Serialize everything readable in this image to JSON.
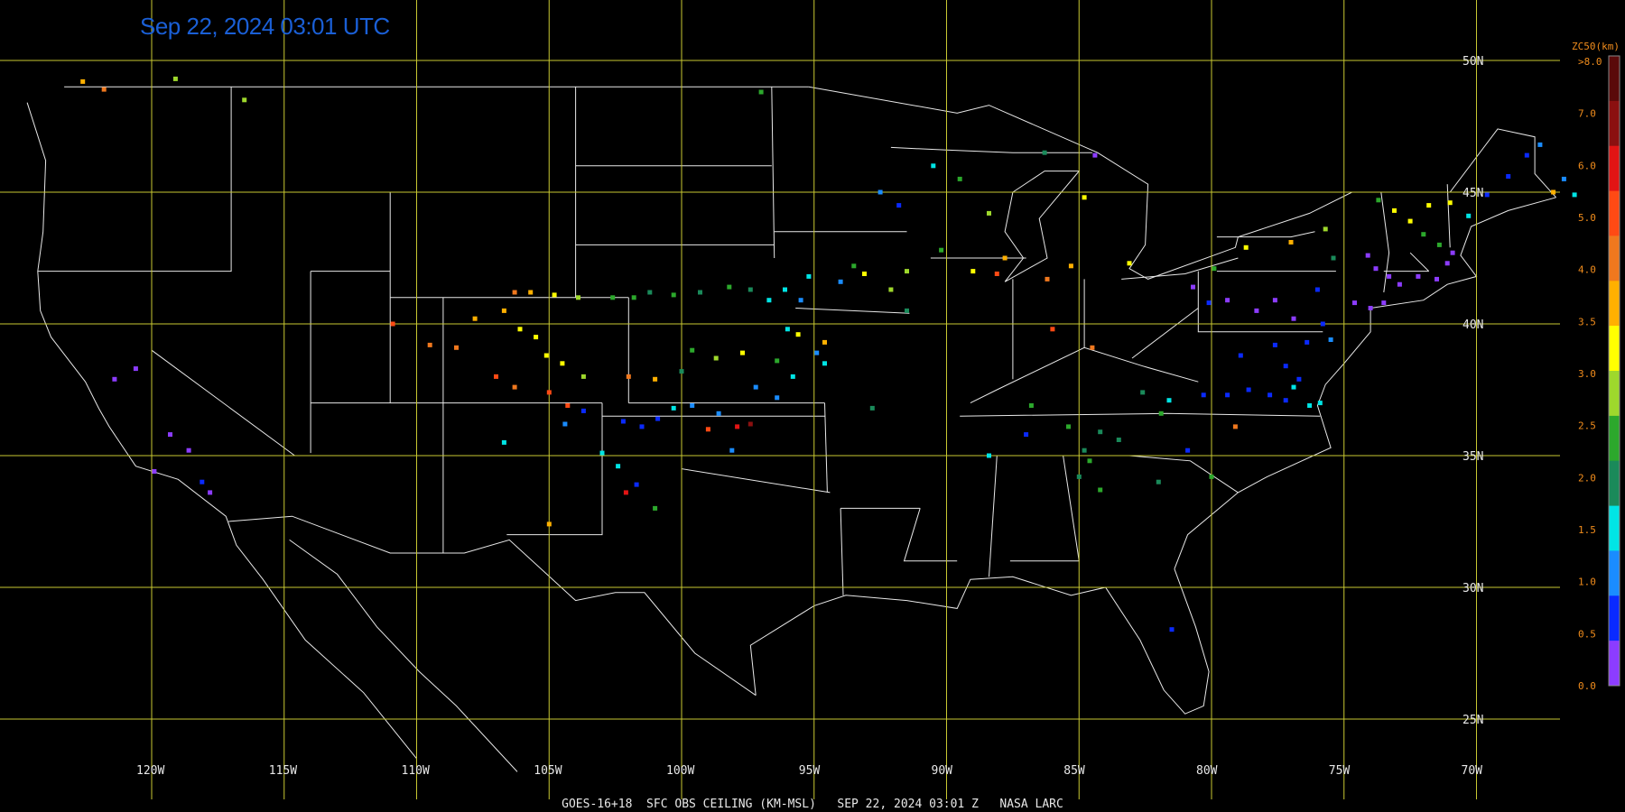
{
  "title": "Sep 22, 2024 03:01 UTC",
  "footer": "GOES-16+18  SFC OBS CEILING (KM-MSL)   SEP 22, 2024 03:01 Z   NASA LARC",
  "grid": {
    "lon_labels": [
      "120W",
      "115W",
      "110W",
      "105W",
      "100W",
      "95W",
      "90W",
      "85W",
      "80W",
      "75W",
      "70W"
    ],
    "lat_labels": [
      "50N",
      "45N",
      "40N",
      "35N",
      "30N",
      "25N"
    ]
  },
  "colorbar": {
    "title": "ZC50(km)",
    "labels": [
      ">8.0",
      "7.0",
      "6.0",
      "5.0",
      "4.0",
      "3.5",
      "3.0",
      "2.5",
      "2.0",
      "1.5",
      "1.0",
      "0.5",
      "0.0"
    ],
    "colors": [
      "#5a0a0a",
      "#8b1010",
      "#e21414",
      "#ff4a14",
      "#f0781e",
      "#ffb000",
      "#ffff00",
      "#9ed82c",
      "#2ca82c",
      "#1a8a5a",
      "#00e5e5",
      "#1a8cff",
      "#0a2aff",
      "#8c3cff"
    ]
  },
  "colors": {
    "grid": "#c8c832",
    "borders": "#e8e8e8",
    "title": "#1a5fd6"
  },
  "observations": [
    [
      -122.6,
      49.2,
      5
    ],
    [
      -121.8,
      48.9,
      4
    ],
    [
      -119.1,
      49.3,
      7
    ],
    [
      -116.5,
      48.5,
      7
    ],
    [
      -97.0,
      48.8,
      8
    ],
    [
      -92.5,
      45.0,
      11
    ],
    [
      -91.8,
      44.5,
      12
    ],
    [
      -90.5,
      46.0,
      10
    ],
    [
      -89.5,
      45.5,
      8
    ],
    [
      -88.4,
      44.2,
      7
    ],
    [
      -90.2,
      42.8,
      8
    ],
    [
      -91.5,
      42.0,
      7
    ],
    [
      -93.5,
      42.2,
      8
    ],
    [
      -94.0,
      41.6,
      11
    ],
    [
      -95.2,
      41.8,
      10
    ],
    [
      -96.1,
      41.3,
      10
    ],
    [
      -95.5,
      40.9,
      11
    ],
    [
      -93.1,
      41.9,
      6
    ],
    [
      -92.1,
      41.3,
      7
    ],
    [
      -91.5,
      40.5,
      9
    ],
    [
      -89.0,
      42.0,
      6
    ],
    [
      -88.1,
      41.9,
      3
    ],
    [
      -87.8,
      42.5,
      5
    ],
    [
      -86.2,
      41.7,
      4
    ],
    [
      -85.3,
      42.2,
      5
    ],
    [
      -86.0,
      39.8,
      3
    ],
    [
      -84.5,
      39.1,
      4
    ],
    [
      -83.1,
      42.3,
      6
    ],
    [
      -84.8,
      44.8,
      6
    ],
    [
      -84.4,
      46.4,
      13
    ],
    [
      -86.3,
      46.5,
      9
    ],
    [
      -106.3,
      41.2,
      4
    ],
    [
      -105.7,
      41.2,
      5
    ],
    [
      -104.8,
      41.1,
      6
    ],
    [
      -103.9,
      41.0,
      7
    ],
    [
      -102.6,
      41.0,
      8
    ],
    [
      -101.8,
      41.0,
      8
    ],
    [
      -101.2,
      41.2,
      9
    ],
    [
      -100.3,
      41.1,
      8
    ],
    [
      -99.3,
      41.2,
      9
    ],
    [
      -98.2,
      41.4,
      8
    ],
    [
      -97.4,
      41.3,
      9
    ],
    [
      -96.7,
      40.9,
      10
    ],
    [
      -96.0,
      39.8,
      10
    ],
    [
      -95.6,
      39.6,
      6
    ],
    [
      -94.6,
      39.3,
      5
    ],
    [
      -94.9,
      38.9,
      11
    ],
    [
      -94.6,
      38.5,
      10
    ],
    [
      -96.4,
      38.6,
      8
    ],
    [
      -97.7,
      38.9,
      6
    ],
    [
      -98.7,
      38.7,
      7
    ],
    [
      -99.6,
      39.0,
      8
    ],
    [
      -100.0,
      38.2,
      9
    ],
    [
      -101.0,
      37.9,
      5
    ],
    [
      -102.0,
      38.0,
      4
    ],
    [
      -103.7,
      38.0,
      7
    ],
    [
      -104.5,
      38.5,
      6
    ],
    [
      -105.1,
      38.8,
      6
    ],
    [
      -105.5,
      39.5,
      6
    ],
    [
      -106.1,
      39.8,
      6
    ],
    [
      -106.7,
      40.5,
      5
    ],
    [
      -107.8,
      40.2,
      5
    ],
    [
      -108.5,
      39.1,
      4
    ],
    [
      -109.5,
      39.2,
      4
    ],
    [
      -110.9,
      40.0,
      3
    ],
    [
      -107.0,
      38.0,
      3
    ],
    [
      -106.3,
      37.6,
      4
    ],
    [
      -105.0,
      37.4,
      3
    ],
    [
      -104.3,
      36.9,
      3
    ],
    [
      -103.7,
      36.7,
      12
    ],
    [
      -102.2,
      36.3,
      12
    ],
    [
      -101.5,
      36.1,
      12
    ],
    [
      -100.9,
      36.4,
      12
    ],
    [
      -100.3,
      36.8,
      10
    ],
    [
      -99.6,
      36.9,
      11
    ],
    [
      -98.6,
      36.6,
      11
    ],
    [
      -97.9,
      36.1,
      2
    ],
    [
      -97.4,
      36.2,
      1
    ],
    [
      -97.2,
      37.6,
      11
    ],
    [
      -96.4,
      37.2,
      11
    ],
    [
      -95.8,
      38.0,
      10
    ],
    [
      -103.0,
      35.1,
      10
    ],
    [
      -102.4,
      34.6,
      10
    ],
    [
      -101.7,
      33.9,
      12
    ],
    [
      -102.1,
      33.6,
      2
    ],
    [
      -101.0,
      33.0,
      8
    ],
    [
      -99.0,
      36.0,
      3
    ],
    [
      -98.1,
      35.2,
      11
    ],
    [
      -104.4,
      36.2,
      11
    ],
    [
      -106.7,
      35.5,
      10
    ],
    [
      -105.0,
      32.4,
      5
    ],
    [
      -92.8,
      36.8,
      9
    ],
    [
      -88.4,
      35.0,
      10
    ],
    [
      -87.0,
      35.8,
      12
    ],
    [
      -86.8,
      36.9,
      8
    ],
    [
      -85.4,
      36.1,
      8
    ],
    [
      -84.8,
      35.2,
      9
    ],
    [
      -84.2,
      35.9,
      9
    ],
    [
      -83.5,
      35.6,
      9
    ],
    [
      -81.9,
      36.6,
      8
    ],
    [
      -82.6,
      37.4,
      9
    ],
    [
      -81.6,
      37.1,
      10
    ],
    [
      -80.3,
      37.3,
      12
    ],
    [
      -79.4,
      37.3,
      12
    ],
    [
      -78.6,
      37.5,
      12
    ],
    [
      -77.8,
      37.3,
      12
    ],
    [
      -77.2,
      37.1,
      12
    ],
    [
      -76.9,
      37.6,
      10
    ],
    [
      -76.3,
      36.9,
      10
    ],
    [
      -75.9,
      37.0,
      10
    ],
    [
      -76.7,
      37.9,
      12
    ],
    [
      -77.2,
      38.4,
      12
    ],
    [
      -78.9,
      38.8,
      12
    ],
    [
      -77.6,
      39.2,
      12
    ],
    [
      -76.4,
      39.3,
      12
    ],
    [
      -75.5,
      39.4,
      11
    ],
    [
      -75.8,
      40.0,
      12
    ],
    [
      -76.9,
      40.2,
      13
    ],
    [
      -77.6,
      40.9,
      13
    ],
    [
      -78.3,
      40.5,
      13
    ],
    [
      -79.4,
      40.9,
      13
    ],
    [
      -80.1,
      40.8,
      12
    ],
    [
      -80.7,
      41.4,
      13
    ],
    [
      -79.9,
      42.1,
      8
    ],
    [
      -78.7,
      42.9,
      6
    ],
    [
      -77.0,
      43.1,
      5
    ],
    [
      -75.7,
      43.6,
      7
    ],
    [
      -74.1,
      42.6,
      13
    ],
    [
      -73.8,
      42.1,
      13
    ],
    [
      -73.3,
      41.8,
      13
    ],
    [
      -72.9,
      41.5,
      13
    ],
    [
      -72.2,
      41.8,
      13
    ],
    [
      -71.5,
      41.7,
      13
    ],
    [
      -71.1,
      42.3,
      13
    ],
    [
      -70.9,
      42.7,
      13
    ],
    [
      -71.4,
      43.0,
      8
    ],
    [
      -72.0,
      43.4,
      8
    ],
    [
      -72.5,
      43.9,
      6
    ],
    [
      -73.1,
      44.3,
      6
    ],
    [
      -73.7,
      44.7,
      8
    ],
    [
      -71.8,
      44.5,
      6
    ],
    [
      -71.0,
      44.6,
      6
    ],
    [
      -70.3,
      44.1,
      10
    ],
    [
      -69.6,
      44.9,
      12
    ],
    [
      -68.8,
      45.6,
      12
    ],
    [
      -68.1,
      46.4,
      12
    ],
    [
      -67.6,
      46.8,
      11
    ],
    [
      -67.1,
      45.0,
      5
    ],
    [
      -66.3,
      44.9,
      10
    ],
    [
      -66.7,
      45.5,
      11
    ],
    [
      -84.2,
      33.7,
      8
    ],
    [
      -85.0,
      34.2,
      9
    ],
    [
      -84.6,
      34.8,
      8
    ],
    [
      -82.0,
      34.0,
      9
    ],
    [
      -80.0,
      34.2,
      8
    ],
    [
      -79.1,
      36.1,
      4
    ],
    [
      -80.9,
      35.2,
      12
    ],
    [
      -81.5,
      28.4,
      12
    ],
    [
      -120.6,
      38.3,
      13
    ],
    [
      -121.4,
      37.9,
      13
    ],
    [
      -119.3,
      35.8,
      13
    ],
    [
      -118.6,
      35.2,
      13
    ],
    [
      -118.1,
      34.0,
      12
    ],
    [
      -117.8,
      33.6,
      13
    ],
    [
      -119.9,
      34.4,
      13
    ],
    [
      -76.0,
      41.3,
      12
    ],
    [
      -75.4,
      42.5,
      9
    ],
    [
      -74.6,
      40.8,
      13
    ],
    [
      -74.0,
      40.6,
      13
    ],
    [
      -73.5,
      40.8,
      13
    ]
  ]
}
